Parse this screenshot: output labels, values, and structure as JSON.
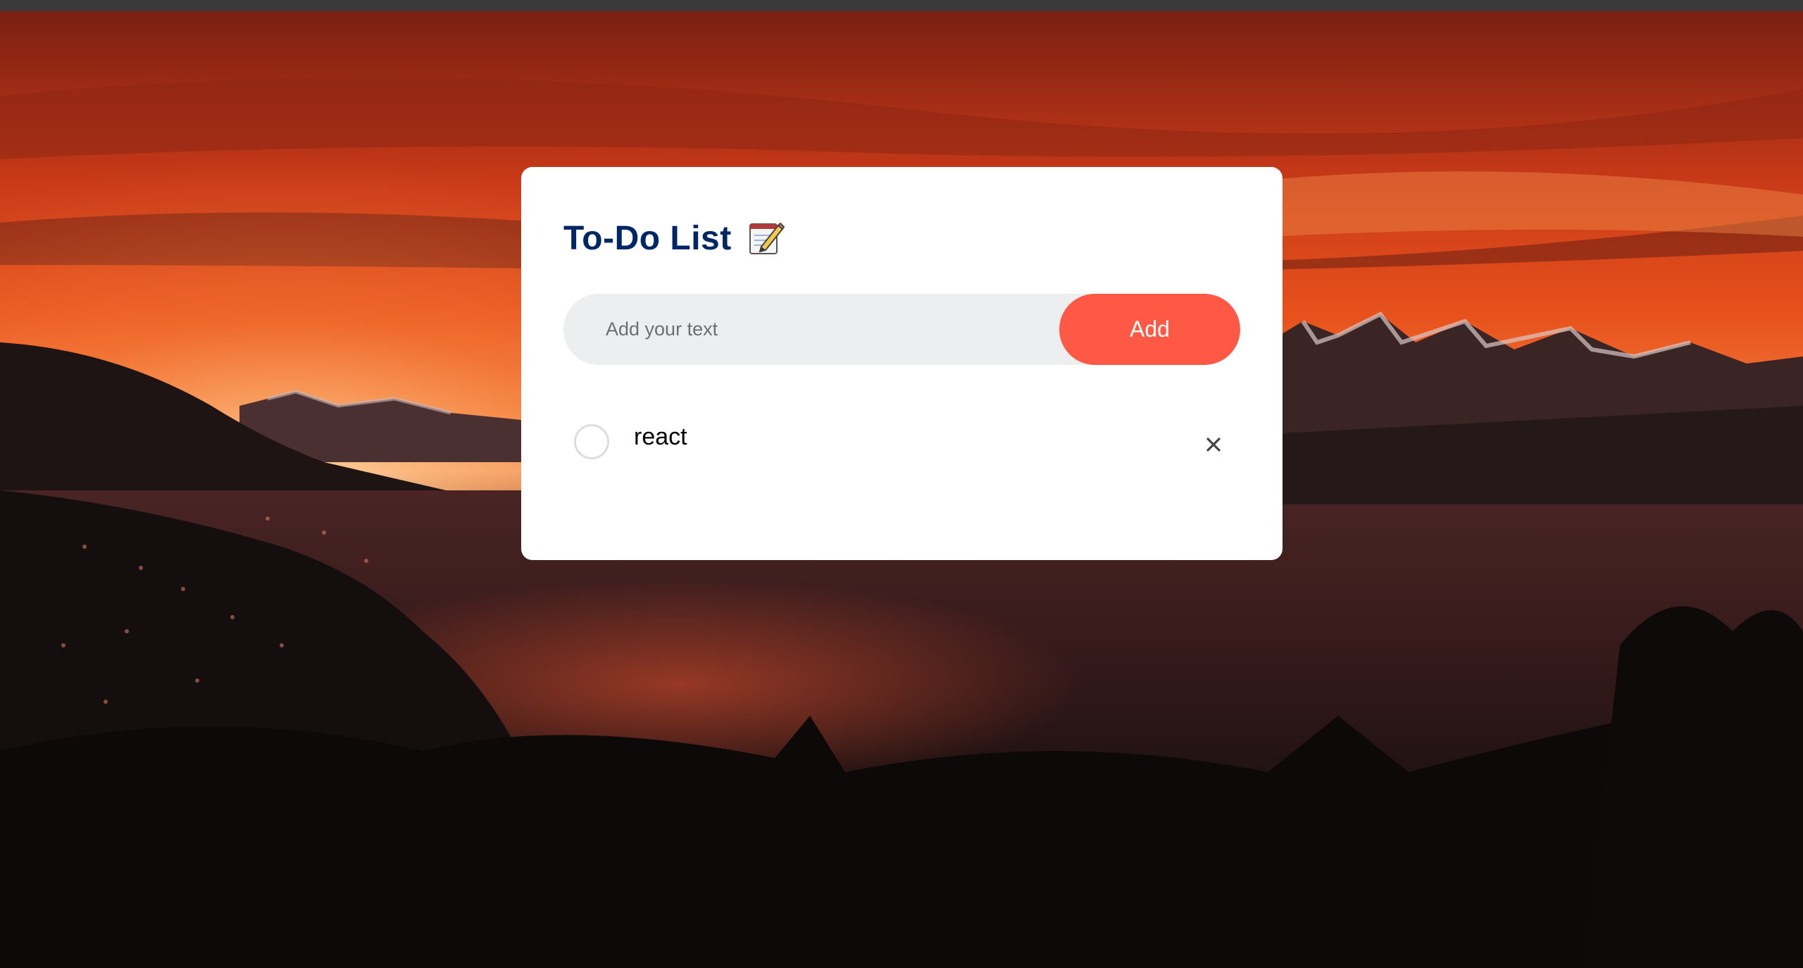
{
  "app": {
    "title": "To-Do List",
    "title_icon": "memo-icon"
  },
  "input": {
    "placeholder": "Add your text",
    "value": ""
  },
  "add_button": {
    "label": "Add"
  },
  "todos": [
    {
      "text": "react",
      "checked": false,
      "remove_icon": "close-icon"
    }
  ],
  "colors": {
    "title": "#002765",
    "accent": "#ff5945",
    "input_bg": "#edeef0",
    "card_bg": "#ffffff"
  }
}
